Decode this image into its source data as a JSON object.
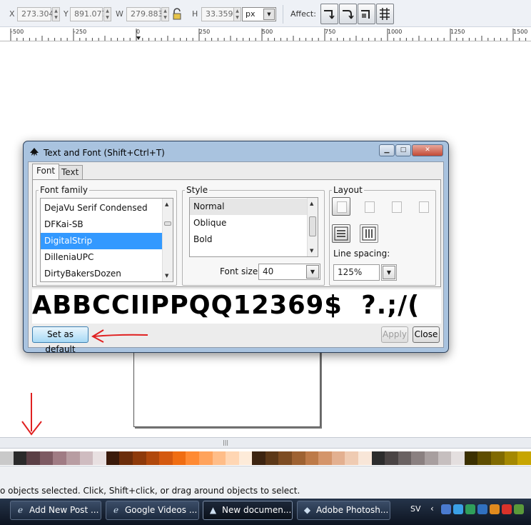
{
  "toolbar": {
    "x_label": "X",
    "x_value": "273.304",
    "y_label": "Y",
    "y_value": "891.077",
    "w_label": "W",
    "w_value": "279.883",
    "h_label": "H",
    "h_value": "33.359",
    "unit": "px",
    "affect_label": "Affect:"
  },
  "ruler": {
    "labels": [
      "-500",
      "-250",
      "0",
      "250",
      "500",
      "750",
      "1000",
      "1250",
      "1500"
    ]
  },
  "dialog": {
    "title": "Text and Font (Shift+Ctrl+T)",
    "tabs": [
      "Font",
      "Text"
    ],
    "font_family": {
      "title": "Font family",
      "items": [
        "DejaVu Serif Condensed",
        "DFKai-SB",
        "DigitalStrip",
        "DilleniaUPC",
        "DirtyBakersDozen"
      ],
      "selected": "DigitalStrip"
    },
    "style": {
      "title": "Style",
      "items": [
        "Normal",
        "Oblique",
        "Bold"
      ],
      "selected": "Normal",
      "font_size_label": "Font size:",
      "font_size_value": "40"
    },
    "layout": {
      "title": "Layout",
      "line_spacing_label": "Line spacing:",
      "line_spacing_value": "125%"
    },
    "preview_text": "ABBCCIIPPQQ12369$  ?.;/(",
    "buttons": {
      "set_default": "Set as default",
      "apply": "Apply",
      "close": "Close"
    }
  },
  "palette": [
    "#c9c9c9",
    "#2a2a2a",
    "#5a3f45",
    "#7d5a62",
    "#a07c84",
    "#b89da2",
    "#cfbcc0",
    "#e8e0e1",
    "#3a1a0a",
    "#6b2d0a",
    "#8e3a0a",
    "#b0480c",
    "#d4590f",
    "#f06d12",
    "#ff8a33",
    "#ffa35c",
    "#ffbd88",
    "#ffd6b3",
    "#fdebd9",
    "#3d2410",
    "#5c3818",
    "#7d4c22",
    "#9e6232",
    "#bd7a48",
    "#d4956a",
    "#e3b090",
    "#efcbb2",
    "#f8e6d8",
    "#2c2c2c",
    "#4a4444",
    "#6a6262",
    "#8a8080",
    "#a89f9f",
    "#c6bfbf",
    "#e4dfdf",
    "#3b3000",
    "#5e4d00",
    "#806a00",
    "#a48800",
    "#c7a500"
  ],
  "status": {
    "text": "o objects selected. Click, Shift+click, or drag around objects to select."
  },
  "taskbar": {
    "items": [
      "Add New Post ...",
      "Google Videos ...",
      "New documen...",
      "Adobe Photosh..."
    ],
    "language": "SV"
  }
}
